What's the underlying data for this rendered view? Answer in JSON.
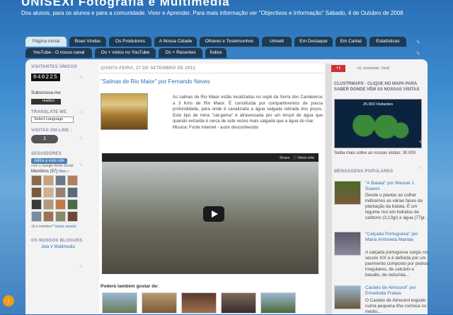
{
  "header": {
    "title": "UNISEXI Fotografia e Multimédia",
    "description": "Dos alunos, para os alunos e para a comunidade. Viver e Aprender. Para mais informação ver \"Objectivos e Informação\" Sábado, 4 de Outubro de 2008"
  },
  "tabs": {
    "row1": [
      "Página inicial",
      "Boas Vindas",
      "Os Produtores",
      "A Nossa Cidade",
      "Olhares e Testemunhos",
      "Uniseti",
      "Em Destaque",
      "Em Cartaz",
      "Estatísticas"
    ],
    "row2": [
      "YouTube - O nosso canal",
      "Os + vistos no YouTube",
      "Os + Recentes",
      "Índice"
    ]
  },
  "left": {
    "visitors_header": "VISITANTES ÚNICOS",
    "visitor_count": "040225",
    "subscribe": "Subscreva-me",
    "readers": "readers",
    "translate_header": "TRANSLATE ME",
    "select_language": "Select Language",
    "online_header": "VISITAS ON-LINE :",
    "online_count": "1",
    "followers_header": "SEGUIDORES",
    "join_button": "Adira a este site",
    "with_google": "com o Google Rede Social",
    "members": "Membros (57)",
    "more": "Mais »",
    "already_member": "Já é membro?",
    "sign_in": "Iniciar sessão",
    "blogs_header": "OS NOSSOS BLOGUES",
    "blog1": "Jota V Multimedia"
  },
  "post": {
    "date": "QUINTA-FEIRA, 27 DE SETEMBRO DE 2012",
    "title": "\"Salinas de Rio Maior\" por Fernando Neves",
    "body": "As salinas de Rio Maior estão localizadas no sopé da Serra dos Candeeiros a 3 Kms de Rio Maior. É constituída por compartimentos de pouca profundidade, para onde é canalizada a água salgada retirada dos poços. Este tipo de mina \"sal-gema\" é atravessada por um lençol de água que quando extraída é cerca de sete vezes mais salgada que a água do mar.",
    "source": "Música: Fonte Internet - autor desconhecido",
    "share": "Share",
    "more_info": "More info",
    "also_like": "Poderá também gostar de:"
  },
  "right": {
    "gplus": "+1",
    "gplus_text": "+6, incluindo: Você",
    "clustrmaps_header": "CLUSTRMAPS - CLIQUE NO MAPA PARA SABER DONDE VÊM AS NOSSAS VISITAS",
    "visits_count": "25.963 Visitantes",
    "visits_note": "Saiba mais sobre as nossas visitas: 30.000",
    "popular_header": "MENSAGENS POPULARES",
    "popular": [
      {
        "title": "\"A Batata\" por Manuel J. Soares",
        "text": "Desde o plantar ao colher indicamos as várias fases da plantação da batata. É um legume rico em hidratos de carbono (3,13gr) e água (77gr..."
      },
      {
        "title": "\"Calçada Portuguesa\" por Maria Antonieta Mantas",
        "text": "A calçada portuguesa surgiu no século XIX e é definida por um pavimento composto por pedras irregulares, de calcário e basalto, de reduzida..."
      },
      {
        "title": "Castelo de Almourol\" por Ermelinda Freitas",
        "text": "O Castelo de Almourol erguido numa pequena ilha rochosa no médio..."
      }
    ]
  }
}
